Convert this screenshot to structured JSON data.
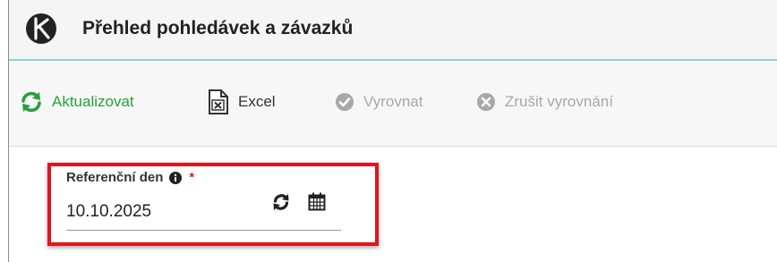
{
  "app": {
    "title": "Přehled pohledávek a závazků"
  },
  "toolbar": {
    "refresh_label": "Aktualizovat",
    "excel_label": "Excel",
    "settle_label": "Vyrovnat",
    "cancel_settle_label": "Zrušit vyrovnání"
  },
  "reference_day": {
    "label": "Referenční den",
    "required_mark": "*",
    "value": "10.10.2025"
  },
  "colors": {
    "accent_green": "#27a13a",
    "highlight_red": "#e0151d",
    "disabled_gray": "#a8a8a8",
    "titlebar_border": "#8fd0de"
  },
  "icons": {
    "app": "app-logo",
    "refresh": "refresh-icon",
    "excel": "excel-icon",
    "settle": "check-circle-icon",
    "cancel": "x-circle-icon",
    "info": "info-icon",
    "field_refresh": "refresh-icon",
    "calendar": "calendar-icon"
  }
}
